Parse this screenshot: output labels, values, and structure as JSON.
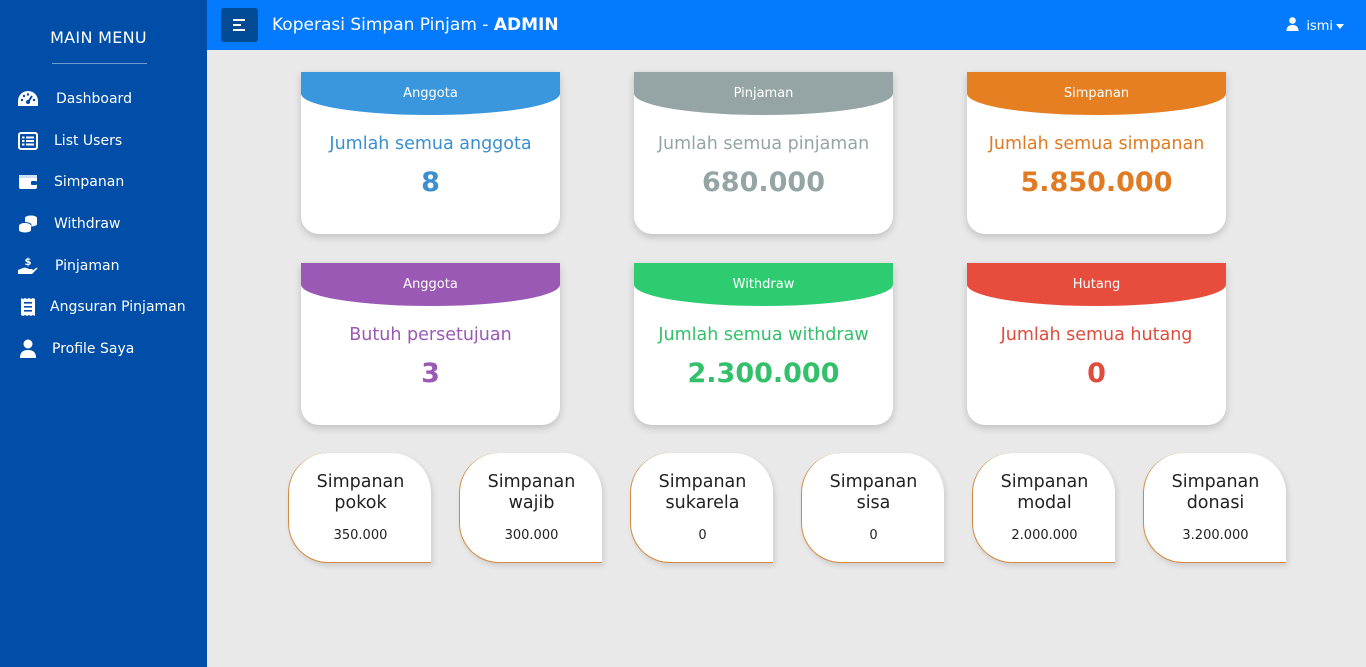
{
  "sidebar": {
    "title": "MAIN MENU",
    "items": [
      {
        "label": "Dashboard",
        "icon": "tachometer-icon"
      },
      {
        "label": "List Users",
        "icon": "list-icon"
      },
      {
        "label": "Simpanan",
        "icon": "wallet-icon"
      },
      {
        "label": "Withdraw",
        "icon": "coins-icon"
      },
      {
        "label": "Pinjaman",
        "icon": "hand-holding-dollar-icon"
      },
      {
        "label": "Angsuran Pinjaman",
        "icon": "receipt-icon"
      },
      {
        "label": "Profile Saya",
        "icon": "user-icon"
      }
    ]
  },
  "topbar": {
    "title_prefix": "Koperasi Simpan Pinjam - ",
    "title_role": "ADMIN",
    "username": "ismi"
  },
  "cards": [
    {
      "header": "Anggota",
      "desc": "Jumlah semua anggota",
      "value": "8",
      "color": "#3a96dd"
    },
    {
      "header": "Pinjaman",
      "desc": "Jumlah semua pinjaman",
      "value": "680.000",
      "color": "#95a5a6"
    },
    {
      "header": "Simpanan",
      "desc": "Jumlah semua simpanan",
      "value": "5.850.000",
      "color": "#e67e22"
    },
    {
      "header": "Anggota",
      "desc": "Butuh persetujuan",
      "value": "3",
      "color": "#9b59b6"
    },
    {
      "header": "Withdraw",
      "desc": "Jumlah semua withdraw",
      "value": "2.300.000",
      "color": "#2ecc71"
    },
    {
      "header": "Hutang",
      "desc": "Jumlah semua hutang",
      "value": "0",
      "color": "#e74c3c"
    }
  ],
  "tiles": [
    {
      "line1": "Simpanan",
      "line2": "pokok",
      "value": "350.000"
    },
    {
      "line1": "Simpanan",
      "line2": "wajib",
      "value": "300.000"
    },
    {
      "line1": "Simpanan",
      "line2": "sukarela",
      "value": "0"
    },
    {
      "line1": "Simpanan",
      "line2": "sisa",
      "value": "0"
    },
    {
      "line1": "Simpanan",
      "line2": "modal",
      "value": "2.000.000"
    },
    {
      "line1": "Simpanan",
      "line2": "donasi",
      "value": "3.200.000"
    }
  ],
  "colors": {
    "sidebar": "#004ea8",
    "topbar": "#047bfe",
    "tile_border": "#d6893e"
  }
}
